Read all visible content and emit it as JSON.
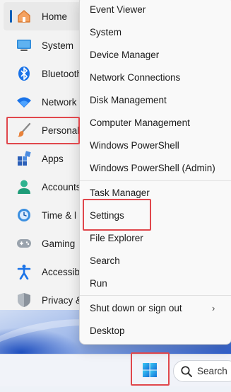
{
  "settings": {
    "items": [
      {
        "label": "Home",
        "icon": "home-icon"
      },
      {
        "label": "System",
        "icon": "monitor-icon"
      },
      {
        "label": "Bluetooth",
        "icon": "bluetooth-icon"
      },
      {
        "label": "Network",
        "icon": "wifi-icon"
      },
      {
        "label": "Personal",
        "icon": "paintbrush-icon"
      },
      {
        "label": "Apps",
        "icon": "apps-icon"
      },
      {
        "label": "Accounts",
        "icon": "person-icon"
      },
      {
        "label": "Time & l",
        "icon": "clock-globe-icon"
      },
      {
        "label": "Gaming",
        "icon": "gamepad-icon"
      },
      {
        "label": "Accessib",
        "icon": "accessibility-icon"
      },
      {
        "label": "Privacy &",
        "icon": "shield-icon"
      }
    ],
    "active_index": 0
  },
  "context_menu": {
    "items": [
      {
        "label": "Event Viewer"
      },
      {
        "label": "System"
      },
      {
        "label": "Device Manager"
      },
      {
        "label": "Network Connections"
      },
      {
        "label": "Disk Management"
      },
      {
        "label": "Computer Management"
      },
      {
        "label": "Windows PowerShell"
      },
      {
        "label": "Windows PowerShell (Admin)"
      },
      {
        "label": "Task Manager"
      },
      {
        "label": "Settings"
      },
      {
        "label": "File Explorer"
      },
      {
        "label": "Search"
      },
      {
        "label": "Run"
      },
      {
        "label": "Shut down or sign out",
        "submenu": true
      },
      {
        "label": "Desktop"
      }
    ],
    "submenu_chevron": "›"
  },
  "taskbar": {
    "start_icon": "windows-logo-icon",
    "search_label": "Search"
  },
  "colors": {
    "highlight": "#e0474c",
    "accent": "#005fb8"
  }
}
